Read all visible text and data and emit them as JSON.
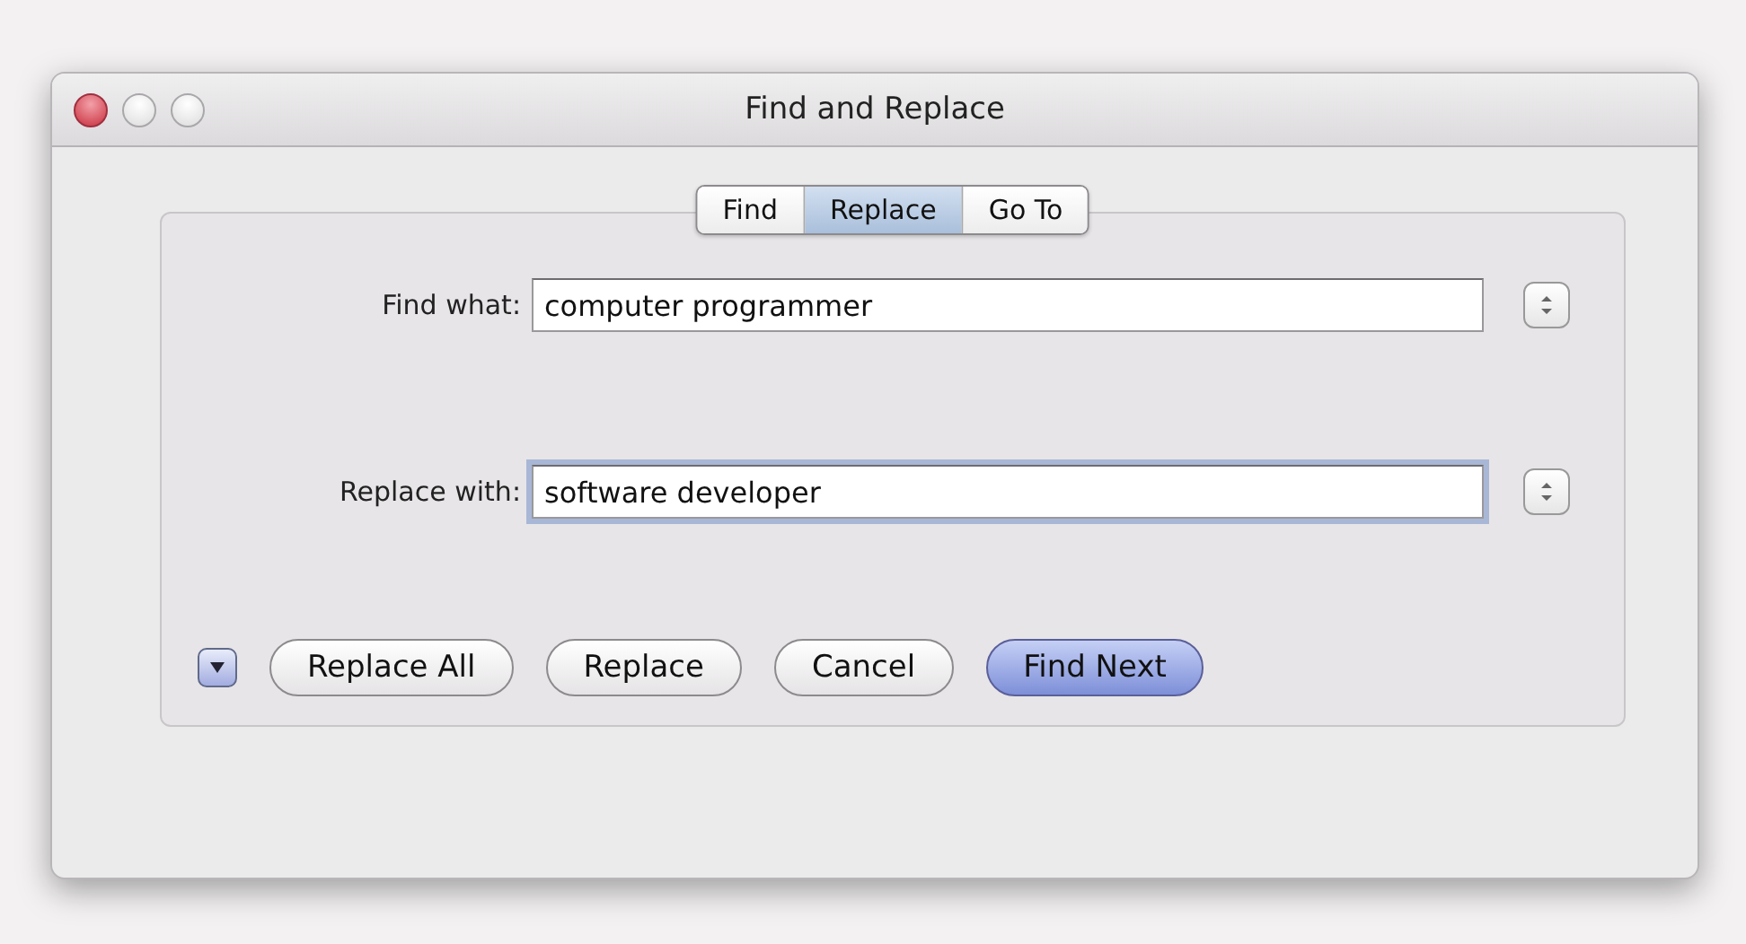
{
  "window": {
    "title": "Find and Replace"
  },
  "tabs": [
    {
      "label": "Find",
      "selected": false
    },
    {
      "label": "Replace",
      "selected": true
    },
    {
      "label": "Go To",
      "selected": false
    }
  ],
  "fields": [
    {
      "label": "Find what:",
      "value": "computer programmer",
      "focused": false
    },
    {
      "label": "Replace with:",
      "value": "software developer",
      "focused": true
    }
  ],
  "buttons": [
    {
      "label": "Replace All",
      "kind": "normal"
    },
    {
      "label": "Replace",
      "kind": "normal"
    },
    {
      "label": "Cancel",
      "kind": "normal"
    },
    {
      "label": "Find Next",
      "kind": "default"
    }
  ]
}
